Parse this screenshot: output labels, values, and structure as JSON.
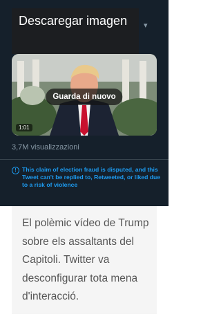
{
  "download_overlay": {
    "label": "Descaregar imagen"
  },
  "video": {
    "replay_label": "Guarda di nuovo",
    "duration": "1:01"
  },
  "tweet": {
    "views": "3,7M visualizzazioni",
    "notice_icon": "!",
    "notice": "This claim of election fraud is disputed, and this Tweet can't be replied to, Retweeted, or liked due to a risk of violence"
  },
  "caption": {
    "text": "El polèmic vídeo de Trump sobre els assaltants del Capitoli. Twitter va desconfigurar tota mena d'interacció."
  },
  "colors": {
    "card_bg": "#15202b",
    "notice": "#1d9bf0",
    "muted": "#8899a6",
    "caption_bg": "#f5f5f5"
  }
}
